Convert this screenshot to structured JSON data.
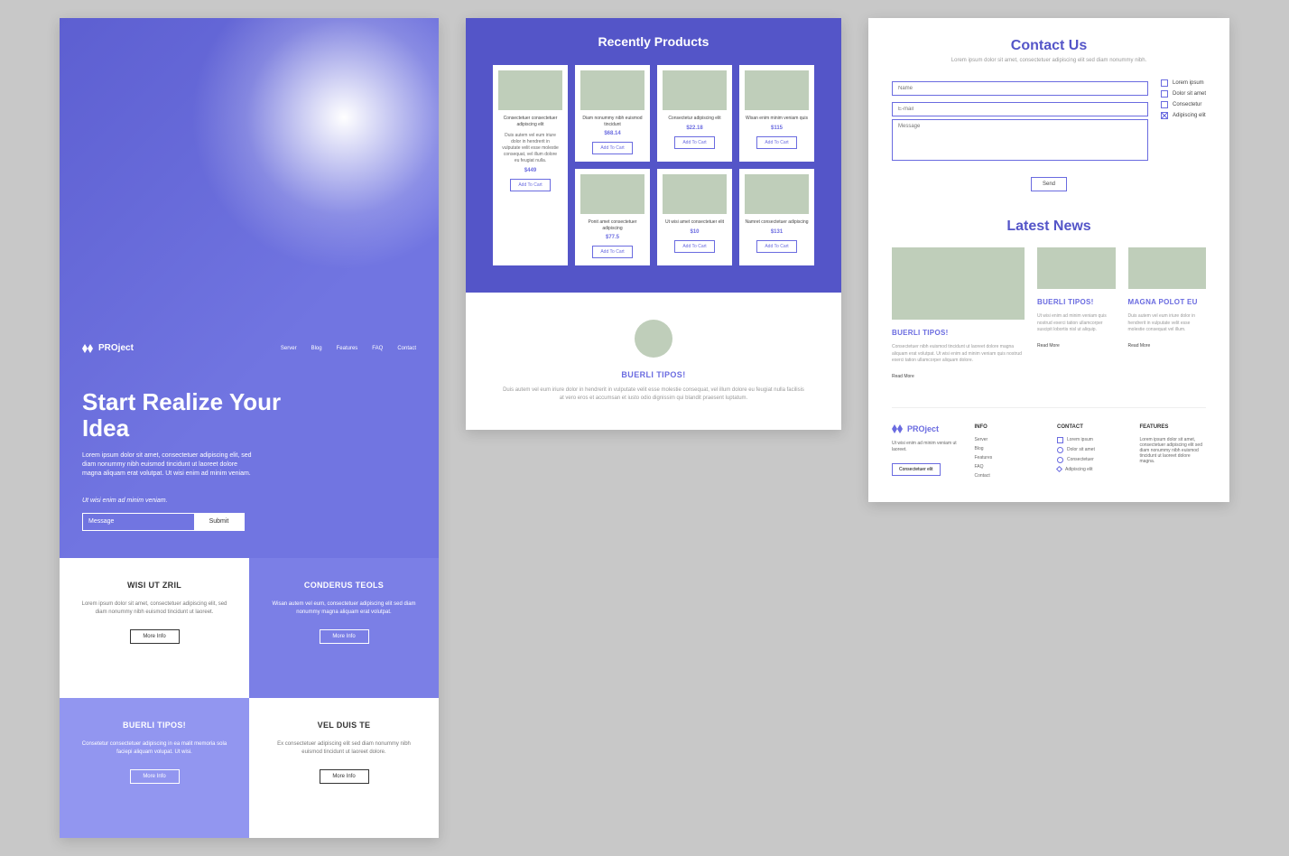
{
  "brand": "PROject",
  "nav": [
    "Server",
    "Blog",
    "Features",
    "FAQ",
    "Contact"
  ],
  "hero": {
    "title": "Start Realize Your Idea",
    "sub": "Lorem ipsum dolor sit amet, consectetuer adipiscing elit, sed diam nonummy nibh euismod tincidunt ut laoreet dolore magna aliquam erat volutpat. Ut wisi enim ad minim veniam.",
    "tag": "Ut wisi enim ad minim veniam.",
    "placeholder": "Message",
    "submit": "Submit"
  },
  "cells": {
    "a": {
      "title": "WISI UT ZRIL",
      "text": "Lorem ipsum dolor sit amet, consectetuer adipiscing elit, sed diam nonummy nibh euismod tincidunt ut laoreet."
    },
    "b": {
      "title": "CONDERUS TEOLS",
      "text": "Wisan autem vel eum, consectetuer adipiscing elit sed diam nonummy magna aliquam erat volutpat."
    },
    "c": {
      "title": "BUERLI TIPOS!",
      "text": "Consetetur consectetuer adipiscing in ea malit memoria sola faciepi aliquam volupat. Ut wisi."
    },
    "d": {
      "title": "VEL DUIS TE",
      "text": "Ex consectetuer adipiscing elit sed diam nonummy nibh euismod tincidunt ut laoreet dolore."
    },
    "more": "More Info"
  },
  "products": {
    "heading": "Recently Products",
    "addToCart": "Add To Cart",
    "items": [
      {
        "text": "Consectetuer consectetuer adipiscing elit",
        "big": "Duis autem vel eum iriure dolor in hendrerit in vulputate velit esse molestie consequat, vel illum dolore eu feugiat nulla.",
        "price": "$449"
      },
      {
        "text": "Diam nonummy nibh euismod tincidunt",
        "price": "$68.14"
      },
      {
        "text": "Consectetur adipiscing elit",
        "price": "$22.18"
      },
      {
        "text": "Wisan enim minim veniam quis",
        "price": "$115"
      },
      {
        "text": "Ponit amet consectetuer adipiscing",
        "price": "$77.5"
      },
      {
        "text": "Ut wisi amet consectetuer elit",
        "price": "$10"
      },
      {
        "text": "Namret consectetuer adipiscing",
        "price": "$131"
      }
    ]
  },
  "testimonial": {
    "title": "BUERLI TIPOS!",
    "text": "Duis autem vel eum iriure dolor in hendrerit in vulputate velit esse molestie consequat, vel illum dolore eu feugiat nulla facilisis at vero eros et accumsan et iusto odio dignissim qui blandit praesent luptatum."
  },
  "contact": {
    "heading": "Contact Us",
    "lead": "Lorem ipsum dolor sit amet, consectetuer adipiscing elit sed diam nonummy nibh.",
    "fields": {
      "name": "Name",
      "email": "E-mail",
      "message": "Message"
    },
    "options": [
      "Lorem ipsum",
      "Dolor sit amet",
      "Consectetur",
      "Adipiscing elit"
    ],
    "send": "Send"
  },
  "news": {
    "heading": "Latest News",
    "readMore": "Read More",
    "items": [
      {
        "title": "BUERLI TIPOS!",
        "text": "Consectetuer nibh euismod tincidunt ut laoreet dolore magna aliquam erat volutpat. Ut wisi enim ad minim veniam quis nostrud exerci tation ullamcorper aliquam dolore."
      },
      {
        "title": "BUERLI TIPOS!",
        "text": "Ut wisi enim ad minim veniam quis nostrud exerci tation ullamcorper suscipit lobortis nisl ut aliquip."
      },
      {
        "title": "MAGNA POLOT EU",
        "text": "Duis autem vel eum iriure dolor in hendrerit in vulputate velit esse molestie consequat vel illum."
      }
    ]
  },
  "footer": {
    "desc": "Ut wisi enim ad minim veniam ut laoreet.",
    "cta": "Consectetuer elit",
    "info": {
      "h": "INFO",
      "items": [
        "Server",
        "Blog",
        "Features",
        "FAQ",
        "Contact"
      ]
    },
    "contact": {
      "h": "CONTACT",
      "items": [
        "Lorem ipsum",
        "Dolor sit amet",
        "Consectetuer",
        "Adipiscing elit"
      ]
    },
    "features": {
      "h": "FEATURES",
      "text": "Lorem ipsum dolor sit amet, consectetuer adipiscing elit sed diam nonummy nibh euismod tincidunt ut laoreet dolore magna."
    }
  }
}
